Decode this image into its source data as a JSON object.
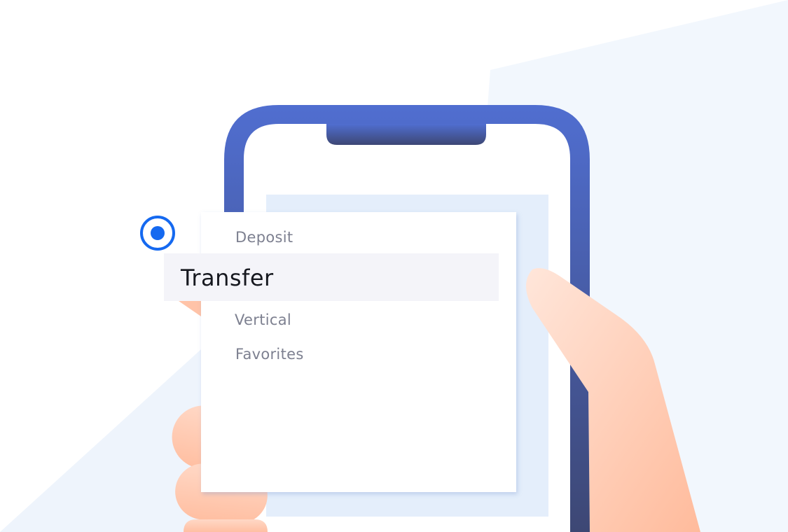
{
  "menu": {
    "items": [
      {
        "label": "Deposit",
        "selected": false
      },
      {
        "label": "Transfer",
        "selected": true
      },
      {
        "label": "Vertical",
        "selected": false
      },
      {
        "label": "Favorites",
        "selected": false
      }
    ]
  },
  "colors": {
    "accent": "#1569f0",
    "phone_top": "#506ed0",
    "phone_bottom": "#3d4774",
    "panel": "#e4eefb",
    "skin": "#ffc3a8"
  }
}
